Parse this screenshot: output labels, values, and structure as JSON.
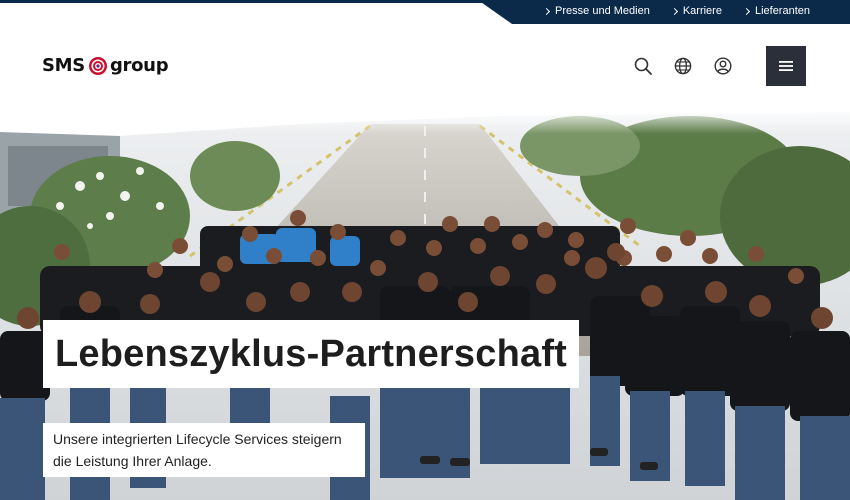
{
  "utility_nav": {
    "items": [
      {
        "label": "Presse und Medien"
      },
      {
        "label": "Karriere"
      },
      {
        "label": "Lieferanten"
      }
    ]
  },
  "header": {
    "logo_left": "SMS",
    "logo_right": "group",
    "icons": [
      "search-icon",
      "globe-icon",
      "user-icon",
      "menu-icon"
    ]
  },
  "hero": {
    "heading": "Lebenszyklus-Partnerschaft",
    "subtext_line1": "Unsere integrierten Lifecycle Services steigern",
    "subtext_line2": "die Leistung Ihrer Anlage."
  },
  "colors": {
    "navy": "#0b2a4a",
    "menu_button": "#2b2f3a",
    "logo_red": "#c8102e",
    "shirt": "#1b1c20",
    "jeans": "#3a5577"
  }
}
